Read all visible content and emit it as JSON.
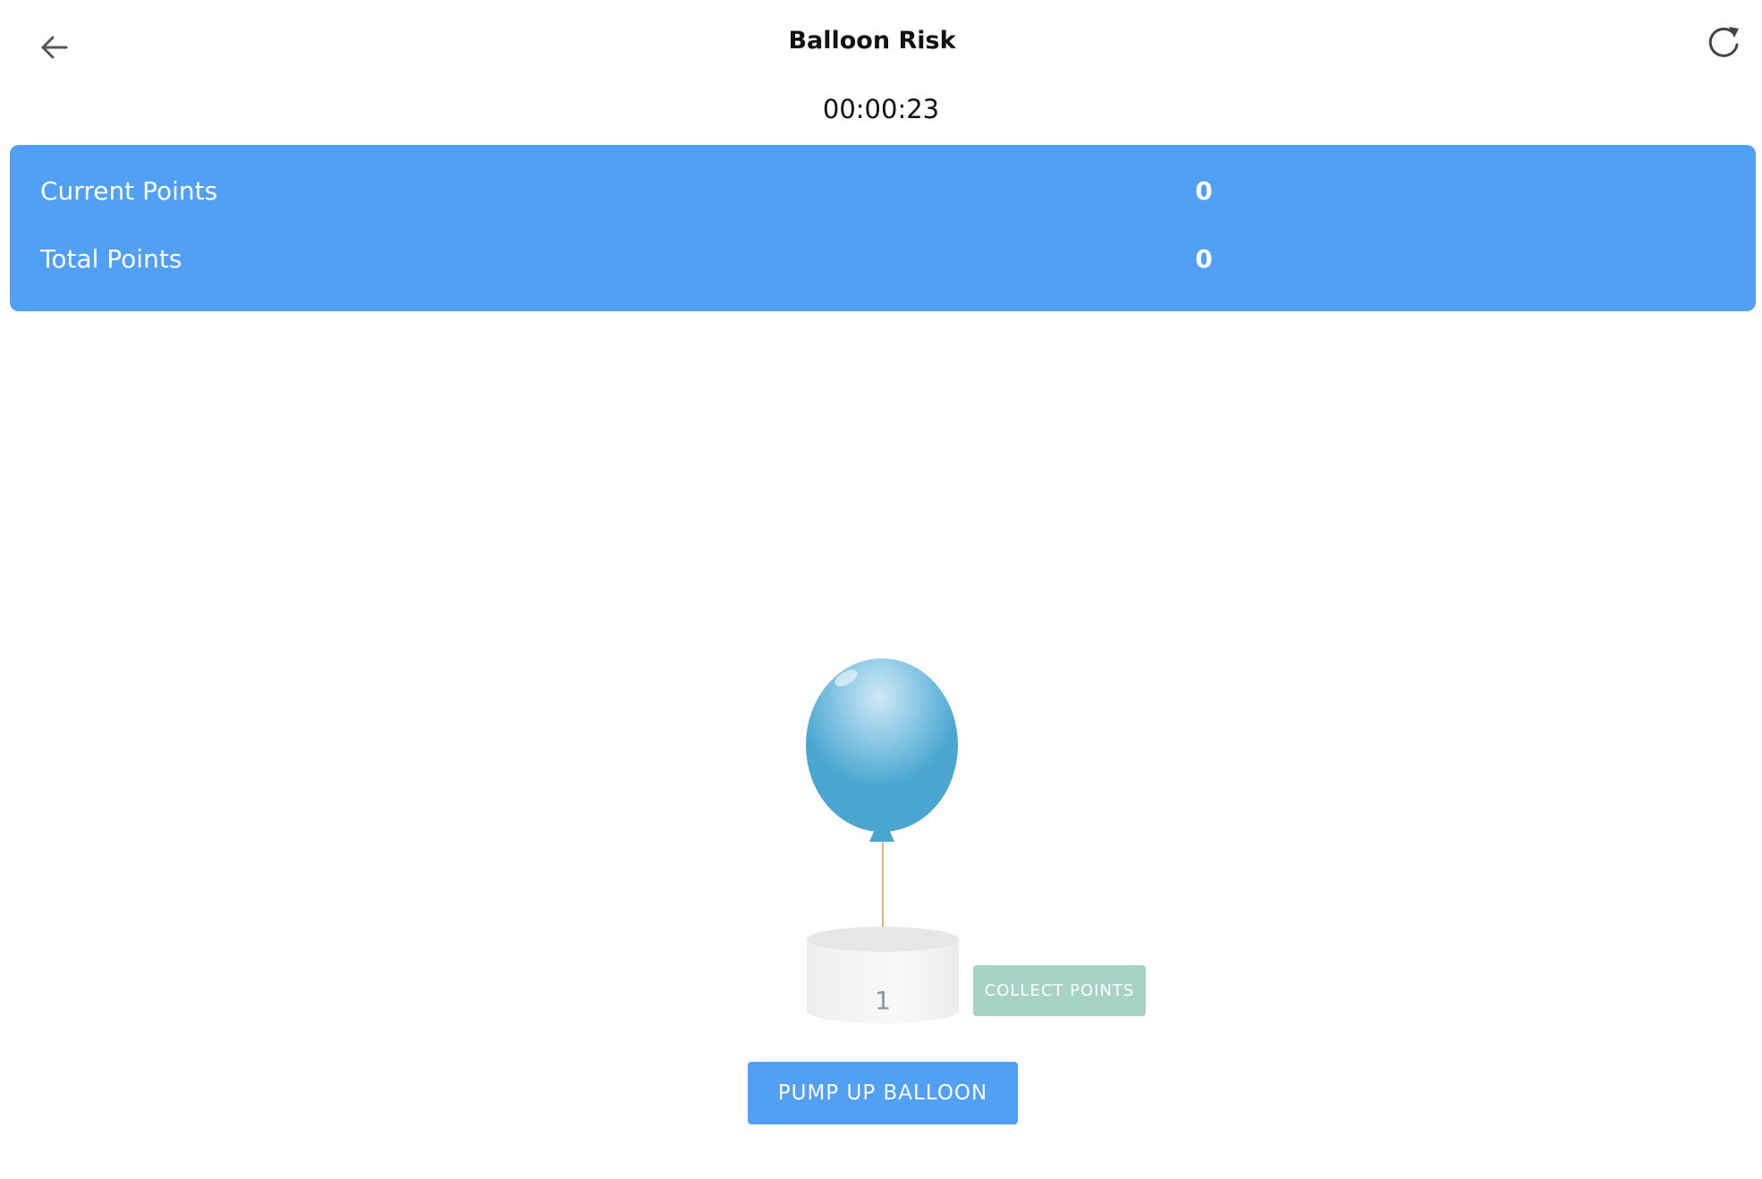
{
  "header": {
    "title": "Balloon Risk",
    "back_icon": "arrow-left-icon",
    "reload_icon": "reload-icon"
  },
  "timer": "00:00:23",
  "scoreboard": {
    "current_label": "Current Points",
    "current_value": "0",
    "total_label": "Total Points",
    "total_value": "0",
    "color": "#529ff6"
  },
  "balloon": {
    "color": "#4aa6cf",
    "pump_count": "1"
  },
  "actions": {
    "collect_label": "COLLECT POINTS",
    "pump_label": "PUMP UP BALLOON"
  }
}
